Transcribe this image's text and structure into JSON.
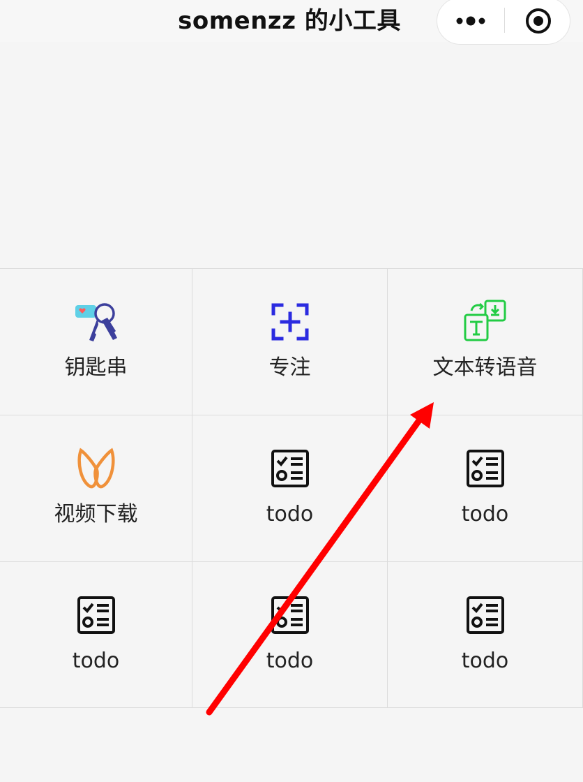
{
  "header": {
    "title": "somenzz 的小工具",
    "more_icon": "more-dots-icon",
    "close_icon": "target-circle-icon"
  },
  "tools": [
    {
      "label": "钥匙串",
      "icon": "keychain-icon"
    },
    {
      "label": "专注",
      "icon": "focus-frame-icon"
    },
    {
      "label": "文本转语音",
      "icon": "text-to-speech-icon"
    },
    {
      "label": "视频下载",
      "icon": "butterfly-icon"
    },
    {
      "label": "todo",
      "icon": "checklist-icon"
    },
    {
      "label": "todo",
      "icon": "checklist-icon"
    },
    {
      "label": "todo",
      "icon": "checklist-icon"
    },
    {
      "label": "todo",
      "icon": "checklist-icon"
    },
    {
      "label": "todo",
      "icon": "checklist-icon"
    }
  ],
  "colors": {
    "background": "#f5f5f5",
    "focus_icon": "#2b2be0",
    "tts_icon": "#22cc44",
    "video_icon": "#f0913a",
    "keychain_tag": "#5fd0e6",
    "keychain_key": "#3c3f9c",
    "annotation_arrow": "#ff0000"
  }
}
